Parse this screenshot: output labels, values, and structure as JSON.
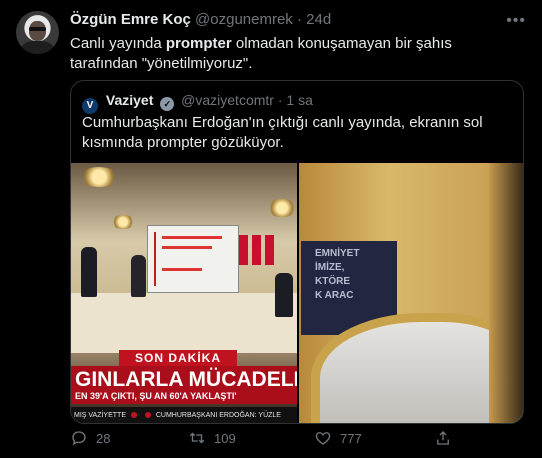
{
  "tweet": {
    "author_name": "Özgün Emre Koç",
    "handle": "@ozgunemrek",
    "time": "24d",
    "text_part1": "Canlı yayında ",
    "text_bold": "prompter",
    "text_part2": " olmadan konuşamayan bir şahıs tarafından \"yönetilmiyoruz\"."
  },
  "quote": {
    "author_name": "Vaziyet",
    "handle": "@vaziyetcomtr",
    "time": "1 sa",
    "text": "Cumhurbaşkanı Erdoğan'ın çıktığı canlı yayında, ekranın sol kısmında prompter gözüküyor.",
    "image_left": {
      "banner": "SON DAKİKA",
      "headline": "GINLARLA MÜCADELESİ",
      "subline": "EN 39'A ÇIKTI, ŞU AN 60'A YAKLAŞTI'",
      "ticker_left": "MIŞ VAZİYETTE",
      "ticker_right": "CUMHURBAŞKANI ERDOĞAN: YÜZLE"
    },
    "image_right": {
      "prompter_lines": [
        "EMNİYET",
        "İMİZE,",
        "KTÖRE",
        "K ARAC"
      ]
    }
  },
  "actions": {
    "replies": "28",
    "retweets": "109",
    "likes": "777"
  },
  "colors": {
    "background": "#000000",
    "muted": "#71767b",
    "text": "#e7e9ea",
    "border": "#2f3336"
  }
}
